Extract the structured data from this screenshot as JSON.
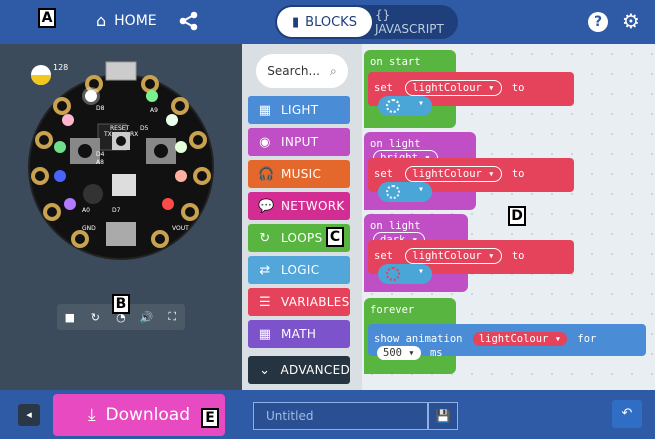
{
  "header": {
    "home_label": "HOME",
    "blocks_label": "BLOCKS",
    "javascript_label": "{} JAVASCRIPT"
  },
  "simulator": {
    "light_level": "128",
    "board_labels": [
      "D8",
      "D4",
      "D5",
      "A8",
      "A9",
      "D7",
      "A0",
      "RESET",
      "TX",
      "RX",
      "GND",
      "VOUT"
    ]
  },
  "toolbox": {
    "search_placeholder": "Search...",
    "categories": [
      {
        "label": "LIGHT",
        "color": "#4a8dd6"
      },
      {
        "label": "INPUT",
        "color": "#c04fc6"
      },
      {
        "label": "MUSIC",
        "color": "#e4672b"
      },
      {
        "label": "NETWORK",
        "color": "#d32d94"
      },
      {
        "label": "LOOPS",
        "color": "#58b53f"
      },
      {
        "label": "LOGIC",
        "color": "#52a6d9"
      },
      {
        "label": "VARIABLES",
        "color": "#e5425b"
      },
      {
        "label": "MATH",
        "color": "#7d53cc"
      },
      {
        "label": "ADVANCED",
        "color": "#263340"
      }
    ]
  },
  "workspace": {
    "on_start": "on start",
    "set": "set",
    "variable": "lightColour",
    "to": "to",
    "on_light": "on light",
    "bright": "bright",
    "dark": "dark",
    "forever": "forever",
    "show_animation": "show animation",
    "for": "for",
    "duration": "500",
    "unit": "ms"
  },
  "bottom": {
    "download_label": "Download",
    "project_name": "Untitled"
  },
  "annotations": [
    "A",
    "B",
    "C",
    "D",
    "E"
  ],
  "colors": {
    "header": "#2e5aa6",
    "loops_green": "#58b53f",
    "variables_red": "#e5425b",
    "download_pink": "#e84bc1"
  }
}
